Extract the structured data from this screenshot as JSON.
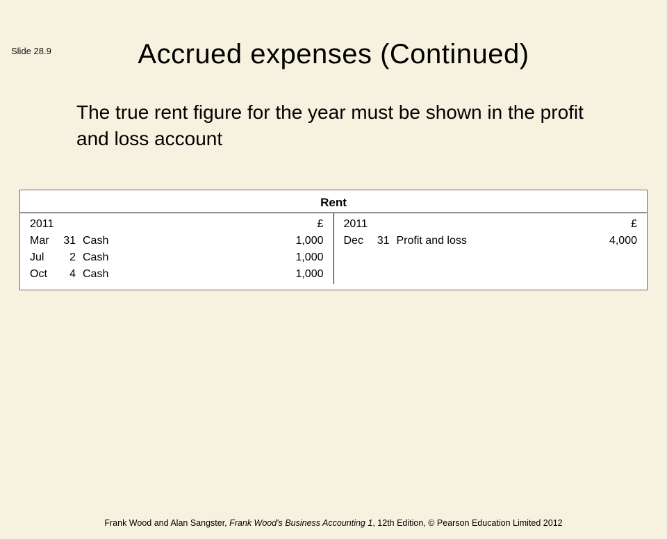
{
  "slide_number": "Slide 28.9",
  "title": "Accrued expenses (Continued)",
  "body": "The true rent figure for the year must be shown in the profit and loss account",
  "ledger": {
    "heading": "Rent",
    "currency": "£",
    "left": {
      "year": "2011",
      "entries": [
        {
          "month": "Mar",
          "day": "31",
          "desc": "Cash",
          "amount": "1,000"
        },
        {
          "month": "Jul",
          "day": "2",
          "desc": "Cash",
          "amount": "1,000"
        },
        {
          "month": "Oct",
          "day": "4",
          "desc": "Cash",
          "amount": "1,000"
        }
      ]
    },
    "right": {
      "year": "2011",
      "entries": [
        {
          "month": "Dec",
          "day": "31",
          "desc": "Profit and loss",
          "amount": "4,000"
        }
      ]
    }
  },
  "footer": {
    "authors": "Frank Wood and Alan Sangster, ",
    "book": "Frank Wood's Business Accounting 1",
    "rest": ", 12th Edition, © Pearson Education Limited 2012"
  }
}
